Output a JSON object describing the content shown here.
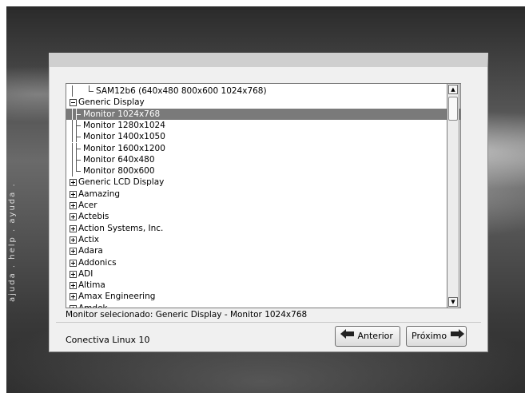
{
  "side_label": "ajuda . help . ayuda .",
  "tree": {
    "rows": [
      {
        "label": "SAM12b6 (640x480 800x600 1024x768)",
        "depth": 2,
        "type": "leaf-last",
        "parent_line": true
      },
      {
        "label": "Generic Display",
        "depth": 0,
        "type": "minus"
      },
      {
        "label": "Monitor 1024x768",
        "depth": 1,
        "type": "leaf",
        "selected": true
      },
      {
        "label": "Monitor 1280x1024",
        "depth": 1,
        "type": "leaf"
      },
      {
        "label": "Monitor 1400x1050",
        "depth": 1,
        "type": "leaf"
      },
      {
        "label": "Monitor 1600x1200",
        "depth": 1,
        "type": "leaf"
      },
      {
        "label": "Monitor 640x480",
        "depth": 1,
        "type": "leaf"
      },
      {
        "label": "Monitor 800x600",
        "depth": 1,
        "type": "leaf-last"
      },
      {
        "label": "Generic LCD Display",
        "depth": 0,
        "type": "plus"
      },
      {
        "label": "Aamazing",
        "depth": 0,
        "type": "plus"
      },
      {
        "label": "Acer",
        "depth": 0,
        "type": "plus"
      },
      {
        "label": "Actebis",
        "depth": 0,
        "type": "plus"
      },
      {
        "label": "Action Systems, Inc.",
        "depth": 0,
        "type": "plus"
      },
      {
        "label": "Actix",
        "depth": 0,
        "type": "plus"
      },
      {
        "label": "Adara",
        "depth": 0,
        "type": "plus"
      },
      {
        "label": "Addonics",
        "depth": 0,
        "type": "plus"
      },
      {
        "label": "ADI",
        "depth": 0,
        "type": "plus"
      },
      {
        "label": "Altima",
        "depth": 0,
        "type": "plus"
      },
      {
        "label": "Amax Engineering",
        "depth": 0,
        "type": "plus"
      },
      {
        "label": "Amdek",
        "depth": 0,
        "type": "plus"
      }
    ]
  },
  "status": {
    "text": "Monitor selecionado: Generic Display  -  Monitor 1024x768"
  },
  "footer": {
    "brand": "Conectiva Linux 10",
    "back_label": "Anterior",
    "next_label": "Próximo"
  },
  "icons": {
    "back": "left-arrow-icon",
    "next": "right-arrow-icon",
    "scroll_up": "scroll-up-arrow-icon",
    "scroll_down": "scroll-down-arrow-icon"
  },
  "colors": {
    "selection": "#7a7a7a",
    "dialog_bg": "#f0f0f0"
  }
}
